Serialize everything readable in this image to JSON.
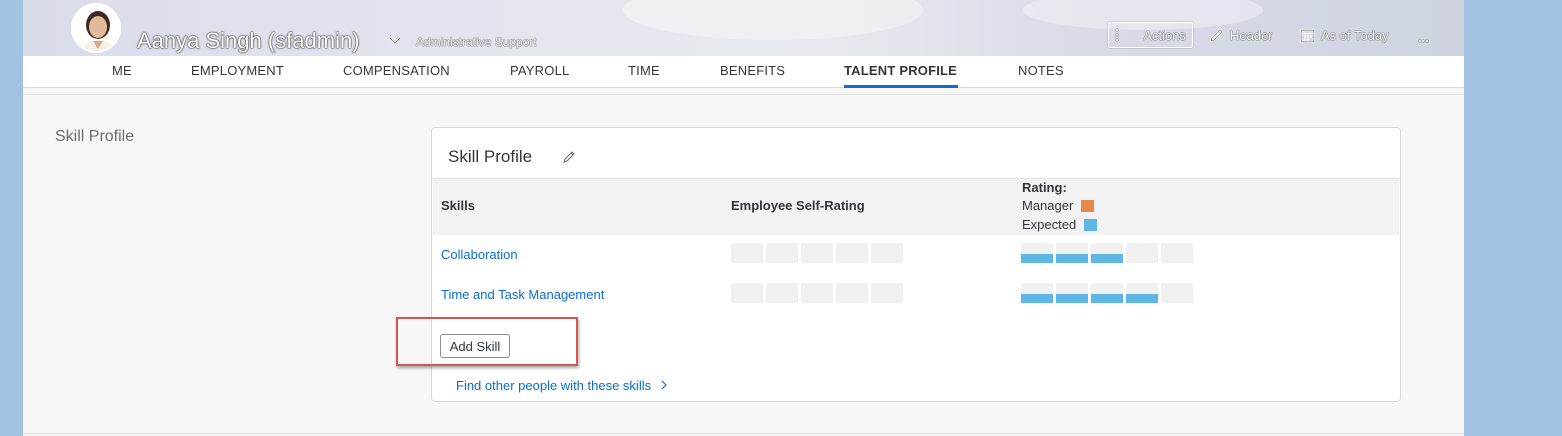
{
  "header": {
    "employee_name": "Aanya Singh (sfadmin)",
    "employee_title": "Administrative Support",
    "actions_label": "Actions",
    "header_label": "Header",
    "as_of_label": "As of Today",
    "more_label": "..."
  },
  "tabs": [
    {
      "label": "ME"
    },
    {
      "label": "EMPLOYMENT"
    },
    {
      "label": "COMPENSATION"
    },
    {
      "label": "PAYROLL"
    },
    {
      "label": "TIME"
    },
    {
      "label": "BENEFITS"
    },
    {
      "label": "TALENT PROFILE",
      "active": true
    },
    {
      "label": "NOTES"
    }
  ],
  "section": {
    "label": "Skill Profile"
  },
  "card": {
    "title": "Skill Profile",
    "columns": {
      "skills": "Skills",
      "self_rating": "Employee Self-Rating",
      "rating": "Rating:"
    },
    "legend": {
      "manager": "Manager",
      "expected": "Expected",
      "manager_color": "#e8894a",
      "expected_color": "#5db6e4"
    },
    "skills": [
      {
        "name": "Collaboration",
        "self_rating": 0,
        "manager_rating": 0,
        "expected_rating": 3,
        "max": 5
      },
      {
        "name": "Time and Task Management",
        "self_rating": 0,
        "manager_rating": 0,
        "expected_rating": 4,
        "max": 5
      }
    ],
    "add_skill_label": "Add Skill",
    "find_link_label": "Find other people with these skills"
  },
  "colors": {
    "accent": "#0a6ed1",
    "highlight": "#d9534f"
  }
}
